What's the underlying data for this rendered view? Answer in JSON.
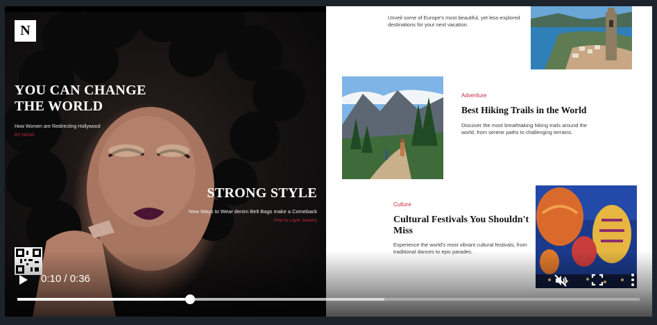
{
  "cover": {
    "logo": "N",
    "headline": "YOU CAN CHANGE THE WORLD",
    "subheadline": "How Women are Redirecting Hollywood",
    "byline": "BY NANA",
    "feature_title": "STRONG STYLE",
    "feature_sub": "New Ways to Wear denim Belt Bags make a Comeback",
    "feature_byline": "How to Layer Jewelry"
  },
  "articles": [
    {
      "category": "",
      "title": "",
      "description": "Unveil some of Europe's most beautiful, yet less-explored destinations for your next vacation.",
      "image": "coastal-town-photo"
    },
    {
      "category": "Adventure",
      "title": "Best Hiking Trails in the World",
      "description": "Discover the most breathtaking hiking trails around the world, from serene paths to challenging terrains.",
      "image": "mountain-trail-photo"
    },
    {
      "category": "Culture",
      "title": "Cultural Festivals You Shouldn't Miss",
      "description": "Experience the world's most vibrant cultural festivals, from traditional dances to epic parades.",
      "image": "hot-air-balloons-photo"
    }
  ],
  "player": {
    "time_display": "0:10 / 0:36",
    "current_seconds": 10,
    "duration_seconds": 36,
    "buffered_fraction": 0.59,
    "muted": true,
    "icons": {
      "play": "play-icon",
      "mute": "volume-muted-icon",
      "fullscreen": "fullscreen-icon",
      "more": "more-vertical-icon"
    }
  },
  "colors": {
    "accent": "#c9283a",
    "background": "#1c232b"
  }
}
